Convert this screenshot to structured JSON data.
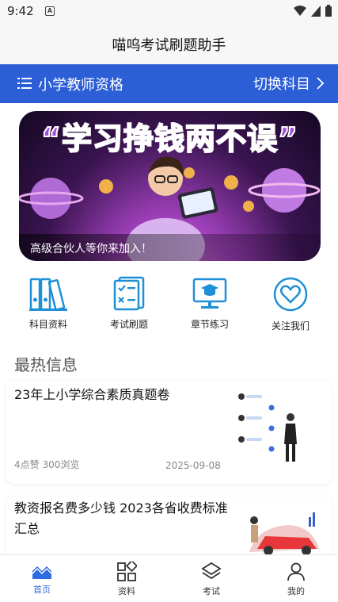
{
  "status_bar": {
    "time": "9:42",
    "notification_icon": "a-box-icon"
  },
  "header": {
    "title": "喵呜考试刷题助手"
  },
  "subject_bar": {
    "subject": "小学教师资格",
    "switch_label": "切换科目"
  },
  "banner": {
    "headline": "“学习挣钱两不误”",
    "caption": "高级合伙人等你来加入！"
  },
  "quick_links": [
    {
      "label": "科目资料",
      "icon": "binders-icon"
    },
    {
      "label": "考试刷题",
      "icon": "checklist-icon"
    },
    {
      "label": "章节练习",
      "icon": "monitor-graduation-icon"
    },
    {
      "label": "关注我们",
      "icon": "heart-icon"
    }
  ],
  "section": {
    "title": "最热信息"
  },
  "articles": [
    {
      "title": "23年上小学综合素质真题卷",
      "likes": "4点赞",
      "views": "300浏览",
      "date": "2025-09-08"
    },
    {
      "title": "教资报名费多少钱 2023各省收费标准汇总"
    }
  ],
  "bottom_nav": [
    {
      "label": "首页",
      "active": true
    },
    {
      "label": "资料"
    },
    {
      "label": "考试"
    },
    {
      "label": "我的"
    }
  ],
  "colors": {
    "accent": "#2c5fd6",
    "icon_blue": "#1f8fd6",
    "nav_active": "#2c6be0"
  }
}
